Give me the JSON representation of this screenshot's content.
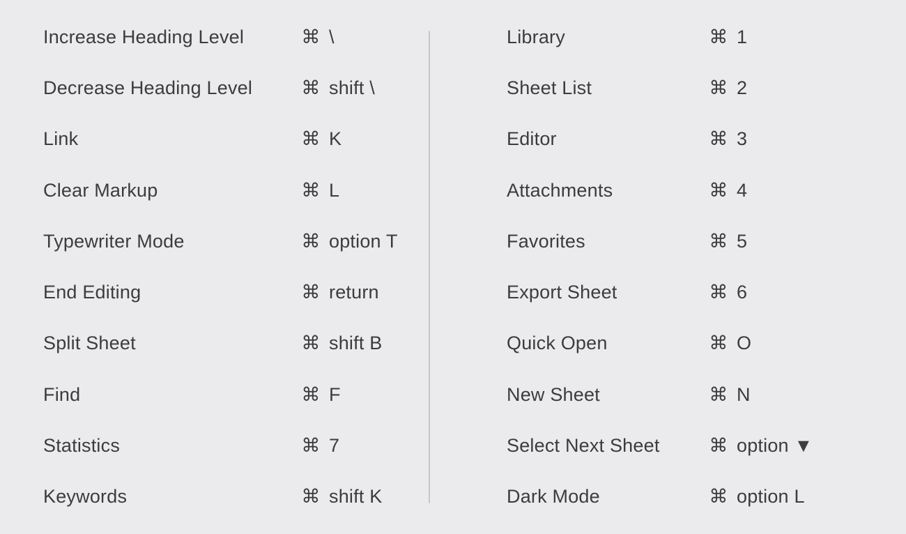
{
  "left": [
    {
      "label": "Increase Heading Level",
      "keys": "\\"
    },
    {
      "label": "Decrease Heading Level",
      "keys": "shift \\"
    },
    {
      "label": "Link",
      "keys": "K"
    },
    {
      "label": "Clear Markup",
      "keys": "L"
    },
    {
      "label": "Typewriter Mode",
      "keys": "option T"
    },
    {
      "label": "End Editing",
      "keys": "return"
    },
    {
      "label": "Split Sheet",
      "keys": "shift B"
    },
    {
      "label": "Find",
      "keys": "F"
    },
    {
      "label": "Statistics",
      "keys": "7"
    },
    {
      "label": "Keywords",
      "keys": "shift K"
    }
  ],
  "right": [
    {
      "label": "Library",
      "keys": "1"
    },
    {
      "label": "Sheet List",
      "keys": "2"
    },
    {
      "label": "Editor",
      "keys": "3"
    },
    {
      "label": "Attachments",
      "keys": "4"
    },
    {
      "label": "Favorites",
      "keys": "5"
    },
    {
      "label": "Export Sheet",
      "keys": "6"
    },
    {
      "label": "Quick Open",
      "keys": "O"
    },
    {
      "label": "New Sheet",
      "keys": "N"
    },
    {
      "label": "Select Next Sheet",
      "keys": "option ▼"
    },
    {
      "label": "Dark Mode",
      "keys": "option L"
    }
  ]
}
